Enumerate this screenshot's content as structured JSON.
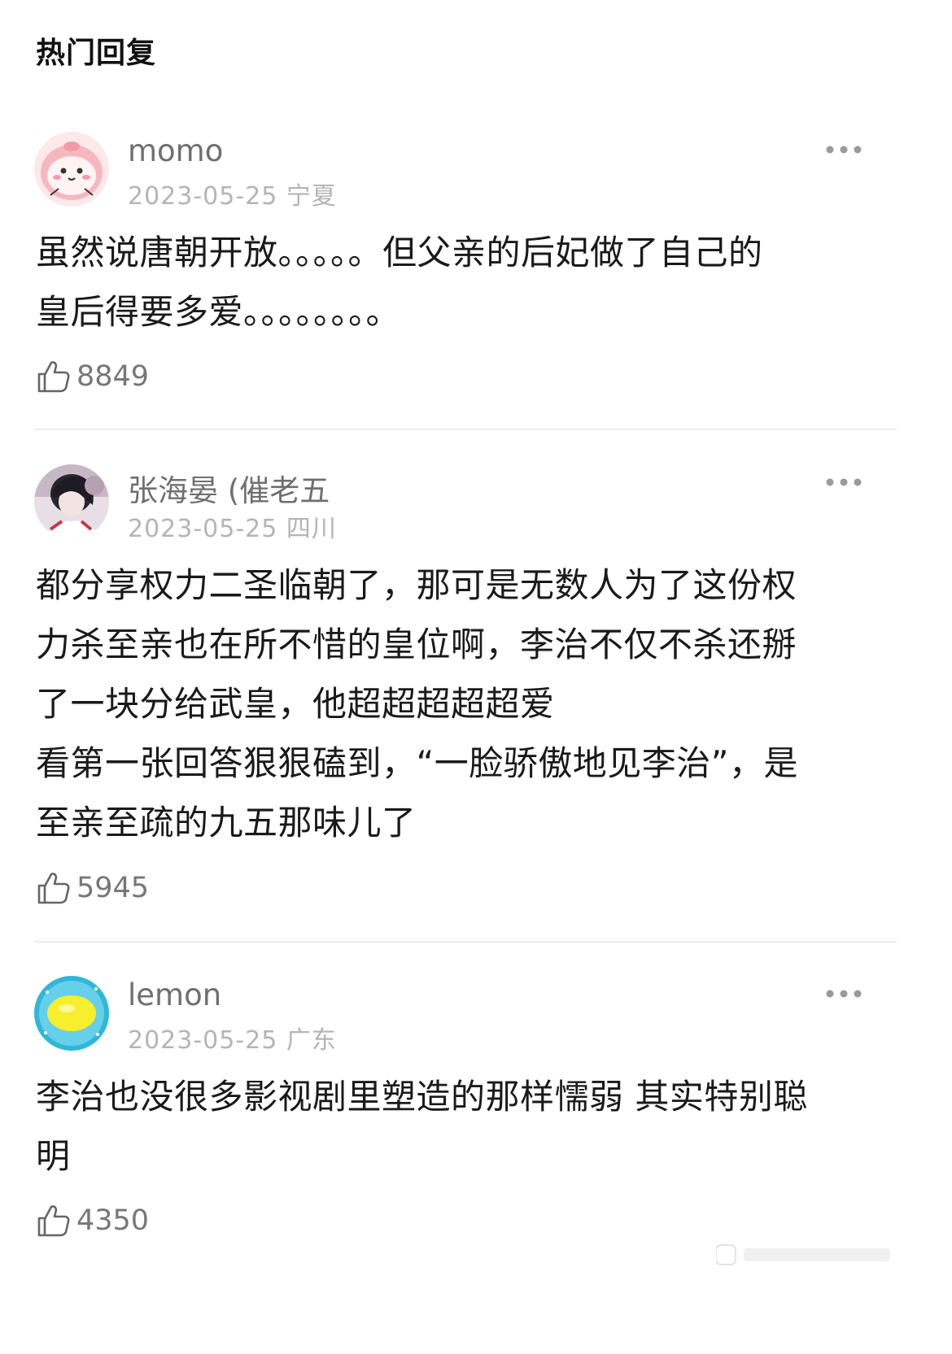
{
  "section_title": "热门回复",
  "colors": {
    "username": "#6f6f6f",
    "meta": "#b4b4b4",
    "body": "#1a1a1a",
    "like_count": "#777777",
    "divider": "#ececec"
  },
  "comments": [
    {
      "username": "momo",
      "date": "2023-05-25",
      "location": "宁夏",
      "meta": "2023-05-25 宁夏",
      "avatar": "pink-cartoon-avatar",
      "text": "虽然说唐朝开放。。。。。但父亲的后妃做了自己的\n皇后得要多爱。。。。。。。。",
      "likes": "8849"
    },
    {
      "username": "张海晏 (催老五",
      "date": "2023-05-25",
      "location": "四川",
      "meta": "2023-05-25 四川",
      "avatar": "anime-character-avatar",
      "text": "都分享权力二圣临朝了，那可是无数人为了这份权\n力杀至亲也在所不惜的皇位啊，李治不仅不杀还掰\n了一块分给武皇，他超超超超超爱\n看第一张回答狠狠磕到，“一脸骄傲地见李治”，是\n至亲至疏的九五那味儿了",
      "likes": "5945"
    },
    {
      "username": "lemon",
      "date": "2023-05-25",
      "location": "广东",
      "meta": "2023-05-25 广东",
      "avatar": "lemon-avatar",
      "text": "李治也没很多影视剧里塑造的那样懦弱 其实特别聪\n明",
      "likes": "4350"
    }
  ],
  "icons": {
    "more": "more-dots-icon",
    "like": "thumbs-up-icon"
  }
}
